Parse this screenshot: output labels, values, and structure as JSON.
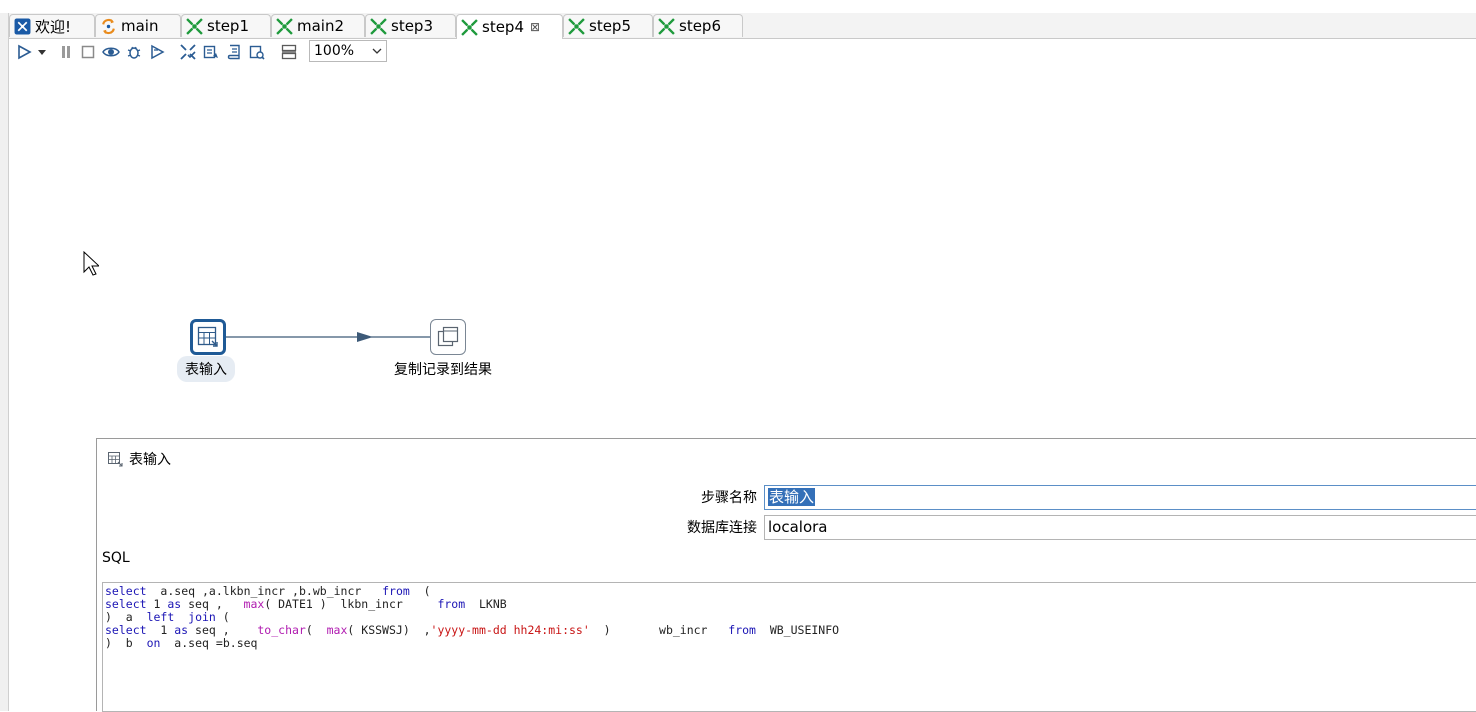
{
  "tabs": [
    {
      "label": "欢迎!",
      "icon": "welcome-icon"
    },
    {
      "label": "main",
      "icon": "job-icon"
    },
    {
      "label": "step1",
      "icon": "transformation-icon"
    },
    {
      "label": "main2",
      "icon": "transformation-icon"
    },
    {
      "label": "step3",
      "icon": "transformation-icon"
    },
    {
      "label": "step4",
      "icon": "transformation-icon",
      "active": true,
      "close": "⊠"
    },
    {
      "label": "step5",
      "icon": "transformation-icon"
    },
    {
      "label": "step6",
      "icon": "transformation-icon"
    }
  ],
  "toolbar": {
    "buttons": [
      "run-icon",
      "run-dropdown-icon",
      "pause-icon",
      "stop-icon",
      "preview-icon",
      "debug-icon",
      "replay-icon",
      "verify-icon",
      "impact-icon",
      "sql-icon",
      "explore-db-icon",
      "show-results-icon"
    ],
    "zoom_value": "100%"
  },
  "canvas": {
    "steps": [
      {
        "name": "表输入",
        "icon": "table-input-icon",
        "selected": true
      },
      {
        "name": "复制记录到结果",
        "icon": "copy-rows-to-result-icon"
      }
    ]
  },
  "dialog": {
    "title": "表输入",
    "step_name_label": "步骤名称",
    "step_name_value": "表输入",
    "connection_label": "数据库连接",
    "connection_value": "localora",
    "sql_label": "SQL",
    "sql_lines": [
      "select  a.seq ,a.lkbn_incr ,b.wb_incr   from  (",
      "select 1 as seq ,   max( DATE1 )  lkbn_incr     from  LKNB",
      ")  a  left  join (",
      "select  1 as seq ,    to_char(  max( KSSWSJ)  ,'yyyy-mm-dd hh24:mi:ss'  )       wb_incr   from  WB_USEINFO",
      ")  b  on  a.seq =b.seq"
    ]
  },
  "colors": {
    "keyword": "#1c16b5",
    "function": "#b01bb0",
    "string": "#c81414",
    "selection": "#3470b8",
    "hop": "#3d5a78"
  }
}
